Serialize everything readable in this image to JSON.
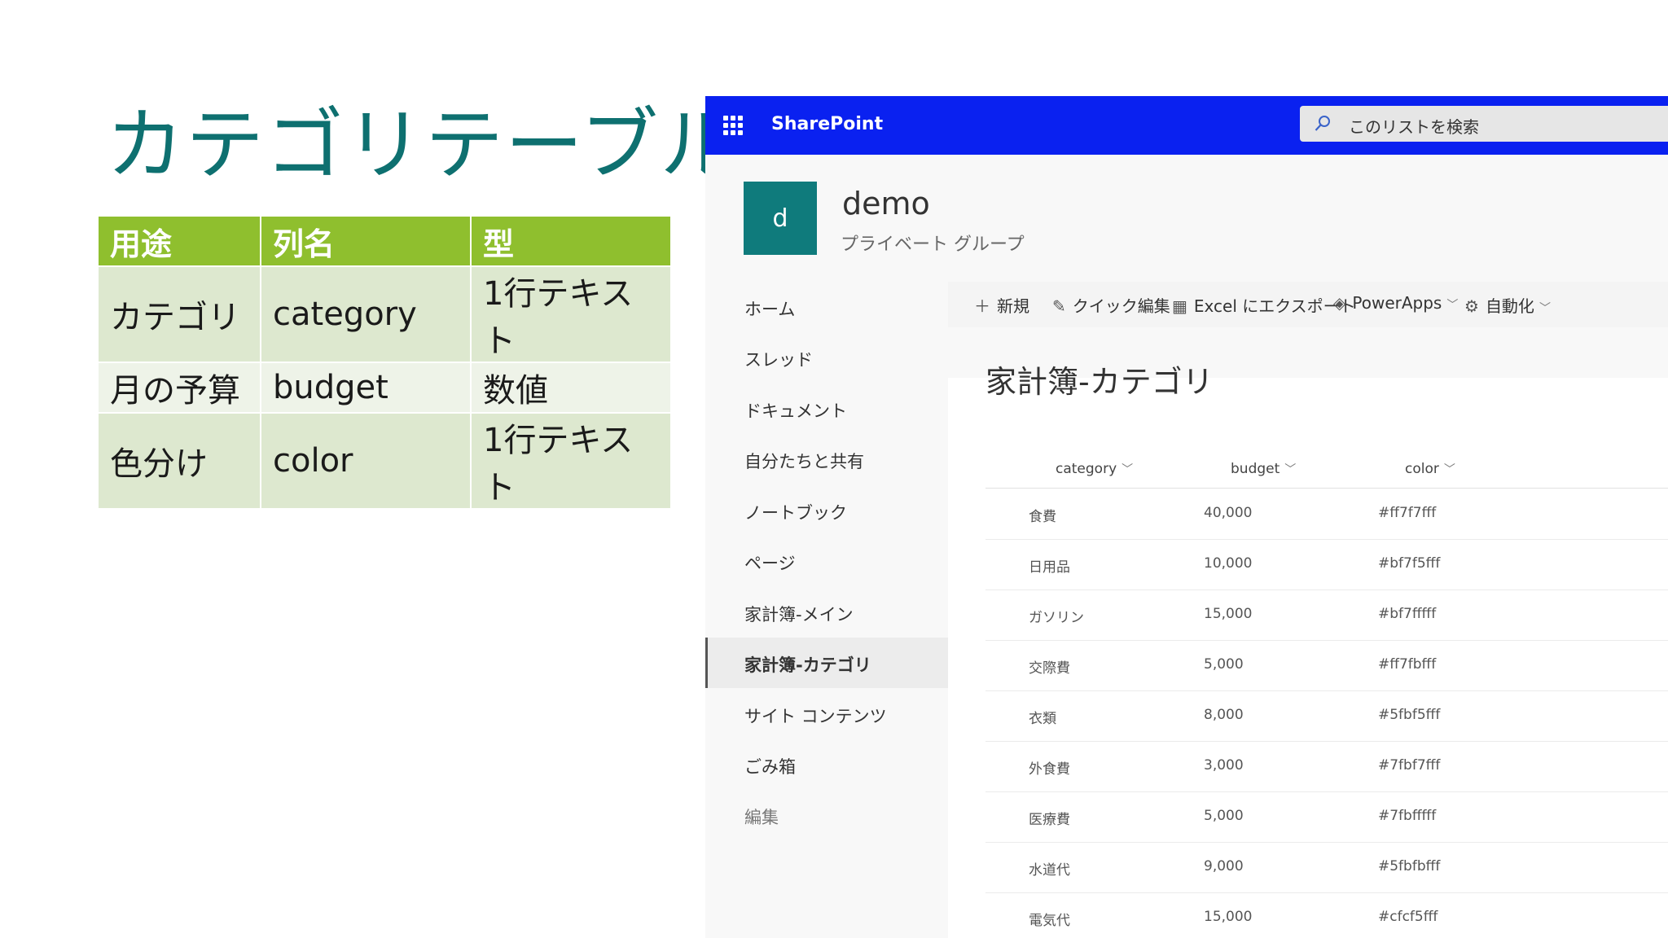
{
  "slide": {
    "title": "カテゴリテーブル",
    "table": {
      "headers": [
        "用途",
        "列名",
        "型"
      ],
      "rows": [
        [
          "カテゴリ",
          "category",
          "1行テキスト"
        ],
        [
          "月の予算",
          "budget",
          "数値"
        ],
        [
          "色分け",
          "color",
          "1行テキスト"
        ]
      ]
    }
  },
  "sharepoint": {
    "brand": "SharePoint",
    "search_placeholder": "このリストを検索",
    "site": {
      "logo_letter": "d",
      "name": "demo",
      "subtitle": "プライベート グループ"
    },
    "nav": {
      "items": [
        {
          "label": "ホーム"
        },
        {
          "label": "スレッド"
        },
        {
          "label": "ドキュメント"
        },
        {
          "label": "自分たちと共有"
        },
        {
          "label": "ノートブック"
        },
        {
          "label": "ページ"
        },
        {
          "label": "家計簿-メイン"
        },
        {
          "label": "家計簿-カテゴリ",
          "selected": true
        },
        {
          "label": "サイト コンテンツ"
        },
        {
          "label": "ごみ箱"
        },
        {
          "label": "編集"
        }
      ]
    },
    "commands": {
      "new": "新規",
      "quick_edit": "クイック編集",
      "export": "Excel にエクスポート",
      "powerapps": "PowerApps",
      "automate": "自動化"
    },
    "list": {
      "title": "家計簿-カテゴリ",
      "columns": [
        "category",
        "budget",
        "color"
      ],
      "rows": [
        [
          "食費",
          "40,000",
          "#ff7f7fff"
        ],
        [
          "日用品",
          "10,000",
          "#bf7f5fff"
        ],
        [
          "ガソリン",
          "15,000",
          "#bf7fffff"
        ],
        [
          "交際費",
          "5,000",
          "#ff7fbfff"
        ],
        [
          "衣類",
          "8,000",
          "#5fbf5fff"
        ],
        [
          "外食費",
          "3,000",
          "#7fbf7fff"
        ],
        [
          "医療費",
          "5,000",
          "#7fbfffff"
        ],
        [
          "水道代",
          "9,000",
          "#5fbfbfff"
        ],
        [
          "電気代",
          "15,000",
          "#cfcf5fff"
        ]
      ]
    }
  },
  "colors": {
    "slide_title": "#0e7070",
    "table_header": "#8fbf2e",
    "suite_bar": "#0a21f0",
    "site_logo": "#0f7b7c"
  }
}
